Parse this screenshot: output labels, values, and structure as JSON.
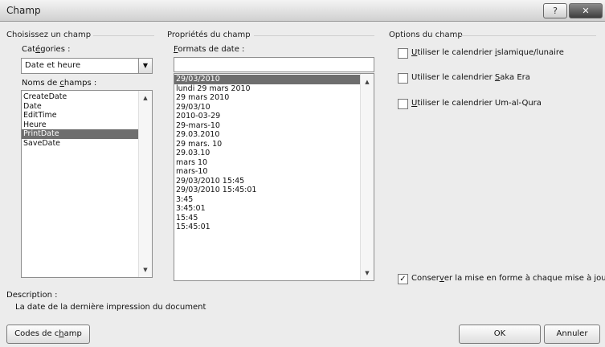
{
  "window": {
    "title": "Champ",
    "help_label": "?",
    "close_label": "✕"
  },
  "left": {
    "group_title": "Choisissez un champ",
    "categories_label": "Catégories :",
    "categories_value": "Date et heure",
    "field_names_label": "Noms de champs :",
    "field_names": [
      "CreateDate",
      "Date",
      "EditTime",
      "Heure",
      "PrintDate",
      "SaveDate"
    ],
    "selected_index": 4
  },
  "middle": {
    "group_title": "Propriétés du champ",
    "formats_label": "Formats de date :",
    "format_input_value": "",
    "formats": [
      "29/03/2010",
      "lundi 29 mars 2010",
      "29 mars 2010",
      "29/03/10",
      "2010-03-29",
      "29-mars-10",
      "29.03.2010",
      "29 mars. 10",
      "29.03.10",
      "mars 10",
      "mars-10",
      "29/03/2010 15:45",
      "29/03/2010 15:45:01",
      "3:45",
      "3:45:01",
      "15:45",
      "15:45:01"
    ],
    "selected_index": 0
  },
  "right": {
    "group_title": "Options du champ",
    "options": [
      {
        "label": "Utiliser le calendrier islamique/lunaire",
        "checked": false
      },
      {
        "label": "Utiliser le calendrier Saka Era",
        "checked": false
      },
      {
        "label": "Utiliser le calendrier Um-al-Qura",
        "checked": false
      }
    ],
    "preserve_format": {
      "label": "Conserver la mise en forme à chaque mise à jour",
      "checked": true
    }
  },
  "description": {
    "label": "Description :",
    "text": "La date de la dernière impression du document"
  },
  "buttons": {
    "field_codes": "Codes de champ",
    "ok": "OK",
    "cancel": "Annuler"
  },
  "glyphs": {
    "dropdown_arrow": "▼",
    "scroll_up": "▲",
    "scroll_down": "▼",
    "checkmark": "✓"
  }
}
